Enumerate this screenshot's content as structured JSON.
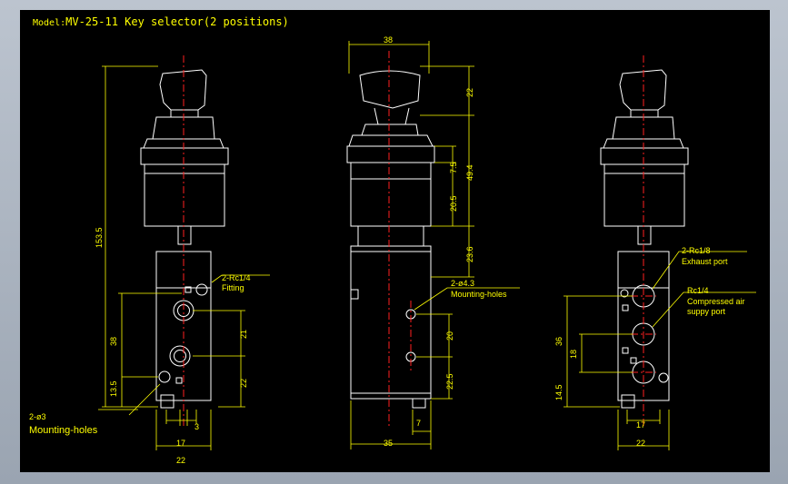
{
  "title_prefix": "Model:",
  "title_main": "MV-25-11 Key selector(2 positions)",
  "colors": {
    "background": "#000000",
    "outline": "#ffffff",
    "dimension": "#ffff00",
    "centerline": "#ff2020",
    "annotation": "#ffff00"
  },
  "views": {
    "left": {
      "dims": {
        "height": "153.5",
        "d38": "38",
        "d13_5": "13.5",
        "d21": "21",
        "d22v": "22",
        "d3": "3",
        "d17": "17",
        "d22h": "22"
      },
      "labels": {
        "fitting_spec": "2-Rc1/4",
        "fitting": "Fitting",
        "holes_spec": "2-ø3",
        "holes": "Mounting-holes"
      }
    },
    "middle": {
      "dims": {
        "width": "38",
        "d22": "22",
        "d49_4": "49.4",
        "d7_5": "7.5",
        "d20_5": "20.5",
        "d23_6": "23.6",
        "d20": "20",
        "d22_5": "22.5",
        "d7": "7",
        "d35": "35"
      },
      "labels": {
        "holes_spec": "2-ø4.3",
        "holes": "Mounting-holes"
      }
    },
    "right": {
      "dims": {
        "d36": "36",
        "d18": "18",
        "d14_5": "14.5",
        "d17": "17",
        "d22": "22"
      },
      "labels": {
        "exhaust_spec": "2-Rc1/8",
        "exhaust": "Exhaust port",
        "supply_spec": "Rc1/4",
        "supply_1": "Compressed air",
        "supply_2": "suppy port"
      }
    }
  }
}
